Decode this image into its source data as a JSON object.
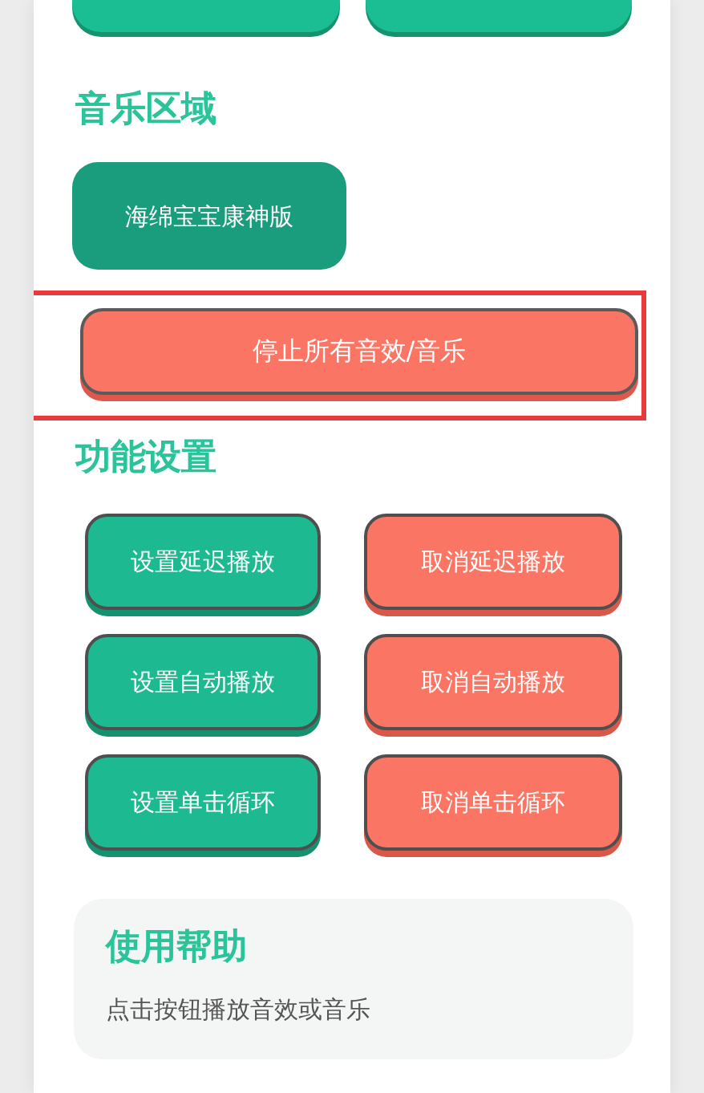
{
  "top_buttons": [
    {
      "kind": "green"
    },
    {
      "kind": "green"
    }
  ],
  "music_section": {
    "title": "音乐区域",
    "buttons": [
      {
        "label": "海绵宝宝康神版"
      }
    ]
  },
  "stop_button": {
    "label": "停止所有音效/音乐",
    "highlighted": true
  },
  "settings_section": {
    "title": "功能设置",
    "buttons": [
      {
        "label": "设置延迟播放",
        "kind": "set"
      },
      {
        "label": "取消延迟播放",
        "kind": "cancel"
      },
      {
        "label": "设置自动播放",
        "kind": "set"
      },
      {
        "label": "取消自动播放",
        "kind": "cancel"
      },
      {
        "label": "设置单击循环",
        "kind": "set"
      },
      {
        "label": "取消单击循环",
        "kind": "cancel"
      }
    ]
  },
  "help": {
    "title": "使用帮助",
    "text": "点击按钮播放音效或音乐"
  }
}
